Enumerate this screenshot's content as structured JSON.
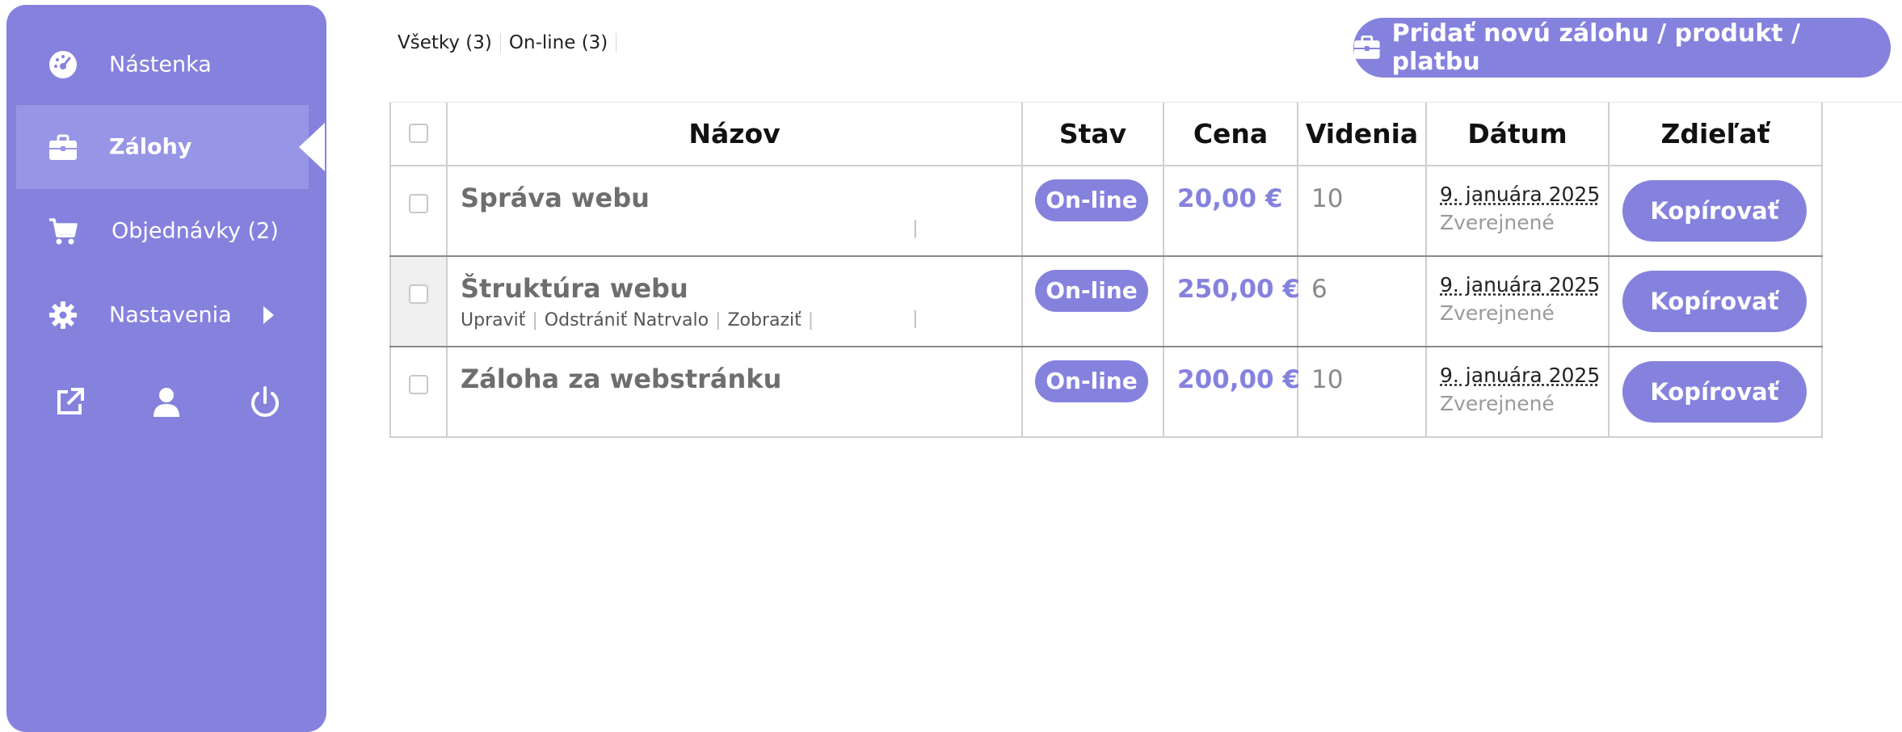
{
  "sidebar": {
    "items": [
      {
        "label": "Nástenka",
        "icon": "dashboard-icon"
      },
      {
        "label": "Zálohy",
        "icon": "briefcase-icon"
      },
      {
        "label": "Objednávky (2)",
        "icon": "cart-icon"
      },
      {
        "label": "Nastavenia",
        "icon": "gear-icon"
      }
    ],
    "bottom_icons": [
      "external-link-icon",
      "user-icon",
      "power-icon"
    ]
  },
  "filters": [
    {
      "label": "Všetky (3)"
    },
    {
      "label": "On-line (3)"
    }
  ],
  "add_button": {
    "label": "Pridať novú zálohu / produkt / platbu",
    "icon": "briefcase-icon"
  },
  "table": {
    "headers": [
      "Názov",
      "Stav",
      "Cena",
      "Videnia",
      "Dátum",
      "Zdieľať"
    ],
    "row_actions": [
      "Upraviť",
      "Odstrániť Natrvalo",
      "Zobraziť"
    ],
    "rows": [
      {
        "title": "Správa webu",
        "status": "On-line",
        "price": "20,00 €",
        "views": "10",
        "date": "9. januára 2025",
        "date_status": "Zverejnené",
        "share": "Kopírovať"
      },
      {
        "title": "Štruktúra webu",
        "status": "On-line",
        "price": "250,00 €",
        "views": "6",
        "date": "9. januára 2025",
        "date_status": "Zverejnené",
        "share": "Kopírovať"
      },
      {
        "title": "Záloha za webstránku",
        "status": "On-line",
        "price": "200,00 €",
        "views": "10",
        "date": "9. januára 2025",
        "date_status": "Zverejnené",
        "share": "Kopírovať"
      }
    ]
  },
  "colors": {
    "accent": "#8582de",
    "sidebar_active": "#9795e5"
  }
}
